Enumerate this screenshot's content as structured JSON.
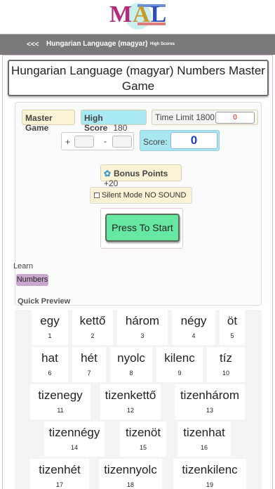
{
  "logo": {
    "text_m": "M",
    "text_a": "A",
    "text_l": "L"
  },
  "nav": {
    "back": "<<<",
    "title": "Hungarian Language (magyar)",
    "high_scores": "High Scores"
  },
  "title": "Hungarian Language (magyar) Numbers Master Game",
  "game": {
    "master_game": "Master Game",
    "high_score_label": "High Score",
    "high_score_value": "180",
    "time_limit_label": "Time Limit 1800",
    "time_value": "0",
    "plus": "+",
    "minus": "-",
    "score_label": "Score:",
    "score_value": "0",
    "bonus_label": "Bonus Points",
    "bonus_value": "+20",
    "silent_label": "Silent Mode NO SOUND",
    "start_label": "Press To Start"
  },
  "learn": {
    "label": "Learn",
    "chip": "Numbers"
  },
  "quick_preview": {
    "label": "Quick Preview",
    "items": [
      {
        "word": "egy",
        "num": "1"
      },
      {
        "word": "kettő",
        "num": "2"
      },
      {
        "word": "három",
        "num": "3"
      },
      {
        "word": "négy",
        "num": "4"
      },
      {
        "word": "öt",
        "num": "5"
      },
      {
        "word": "hat",
        "num": "6"
      },
      {
        "word": "hét",
        "num": "7"
      },
      {
        "word": "nyolc",
        "num": "8"
      },
      {
        "word": "kilenc",
        "num": "9"
      },
      {
        "word": "tíz",
        "num": "10"
      },
      {
        "word": "tizenegy",
        "num": "11"
      },
      {
        "word": "tizenkettő",
        "num": "12"
      },
      {
        "word": "tizenhárom",
        "num": "13"
      },
      {
        "word": "tizennégy",
        "num": "14"
      },
      {
        "word": "tizenöt",
        "num": "15"
      },
      {
        "word": "tizenhat",
        "num": "16"
      },
      {
        "word": "tizenhét",
        "num": "17"
      },
      {
        "word": "tizennyolc",
        "num": "18"
      },
      {
        "word": "tizenkilenc",
        "num": "19"
      }
    ]
  }
}
